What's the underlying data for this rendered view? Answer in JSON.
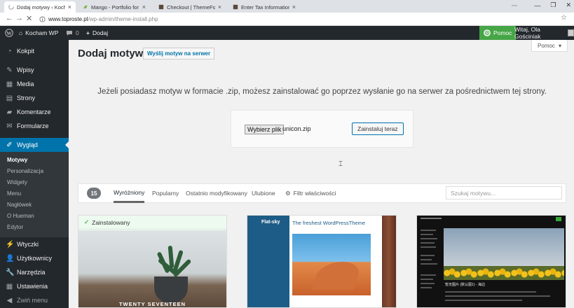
{
  "browser": {
    "tabs": [
      {
        "label": "Dodaj motywy ‹ Kocham WP",
        "active": true
      },
      {
        "label": "Mango - Portfolio for Dr..."
      },
      {
        "label": "Checkout | ThemeForest"
      },
      {
        "label": "Enter Tax Information | T..."
      }
    ],
    "url_host": "www.toproste.pl",
    "url_path": "/wp-admin/theme-install.php"
  },
  "adminbar": {
    "site_name": "Kocham WP",
    "comments_count": "0",
    "add_label": "Dodaj",
    "help_label": "Pomoc",
    "greeting": "Witaj, Ola Gościniak"
  },
  "sidebar": {
    "items": [
      {
        "label": "Kokpit",
        "icon": "dashboard-icon"
      },
      {
        "label": "Wpisy",
        "icon": "pin-icon"
      },
      {
        "label": "Media",
        "icon": "media-icon"
      },
      {
        "label": "Strony",
        "icon": "page-icon"
      },
      {
        "label": "Komentarze",
        "icon": "comment-icon"
      },
      {
        "label": "Formularze",
        "icon": "mail-icon"
      },
      {
        "label": "Wygląd",
        "icon": "brush-icon"
      },
      {
        "label": "Wtyczki",
        "icon": "plugin-icon"
      },
      {
        "label": "Użytkownicy",
        "icon": "users-icon"
      },
      {
        "label": "Narzędzia",
        "icon": "wrench-icon"
      },
      {
        "label": "Ustawienia",
        "icon": "settings-icon"
      },
      {
        "label": "Zwiń menu",
        "icon": "collapse-icon"
      }
    ],
    "submenu": [
      "Motywy",
      "Personalizacja",
      "Widgety",
      "Menu",
      "Nagłówek",
      "O Hueman",
      "Edytor"
    ]
  },
  "page": {
    "title": "Dodaj motywy",
    "upload_button": "Wyślij motyw na serwer",
    "help_tab": "Pomoc",
    "instruction": "Jeżeli posiadasz motyw w formacie .zip, możesz zainstalować go poprzez wysłanie go na serwer za pośrednictwem tej strony.",
    "choose_file": "Wybierz plik",
    "file_name": "unicon.zip",
    "install_button": "Zainstaluj teraz"
  },
  "filter": {
    "count": "15",
    "tabs": [
      "Wyróżniony",
      "Popularny",
      "Ostatnio modyfikowany",
      "Ulubione"
    ],
    "feature_filter": "Filtr właściwości",
    "search_placeholder": "Szukaj motywu..."
  },
  "themes": [
    {
      "installed_label": "Zainstalowany",
      "name": "TWENTY SEVENTEEN"
    },
    {
      "logo": "Flat-sky",
      "headline": "The freshest WordPressTheme"
    },
    {
      "headline": "暂无图片 (默认图1) - 海边"
    }
  ],
  "colors": {
    "admin_dark": "#23282d",
    "admin_blue": "#0073aa",
    "help_green": "#46a546",
    "installed_green": "#46b450"
  }
}
